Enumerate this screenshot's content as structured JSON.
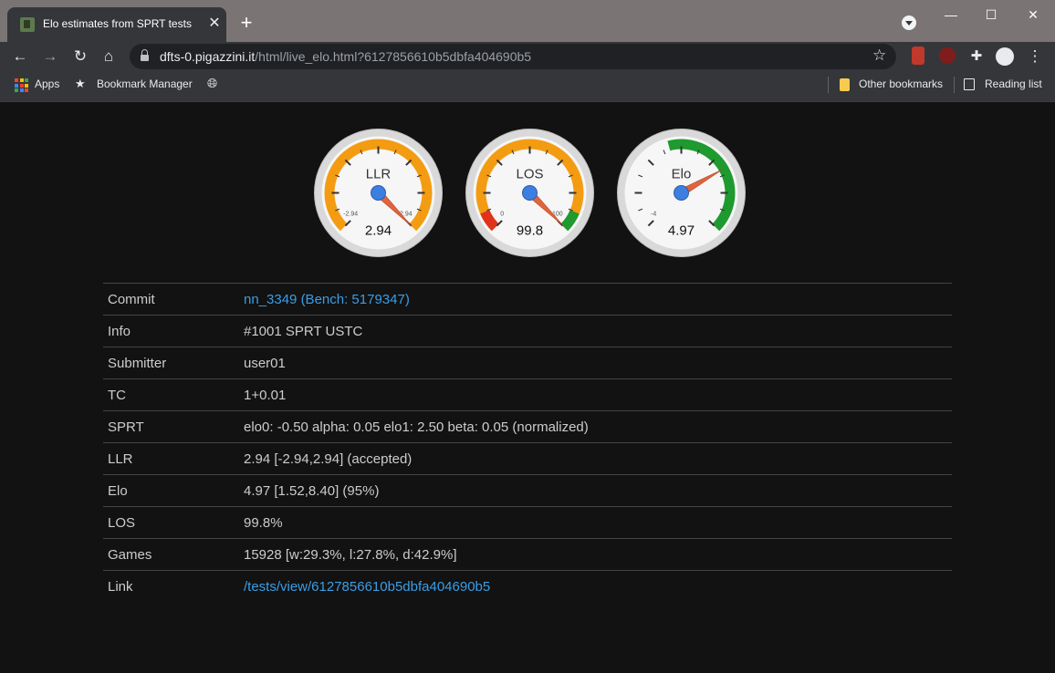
{
  "browser": {
    "tab_title": "Elo estimates from SPRT tests",
    "url_host": "dfts-0.pigazzini.it",
    "url_path": "/html/live_elo.html?6127856610b5dbfa404690b5",
    "bookmarks": [
      "Apps",
      "Bookmark Manager"
    ],
    "other_bookmarks": "Other bookmarks",
    "reading_list": "Reading list"
  },
  "gauges": [
    {
      "name": "LLR",
      "value_text": "2.94",
      "value": 2.94,
      "min": -2.94,
      "max": 2.94,
      "min_label": "-2.94",
      "max_label": "2.94",
      "colors": {
        "red": "#f39c12",
        "green": "#f39c12"
      }
    },
    {
      "name": "LOS",
      "value_text": "99.8",
      "value": 99.8,
      "min": 0,
      "max": 100,
      "min_label": "0",
      "max_label": "100",
      "colors": {
        "red": "#e0331c",
        "green": "#1e9a2e"
      }
    },
    {
      "name": "Elo",
      "value_text": "4.97",
      "value": 4.97,
      "min": -4,
      "max": 8.4,
      "min_label": "-4",
      "max_label": "",
      "colors": {
        "red": "#ffffff",
        "green": "#1e9a2e"
      }
    }
  ],
  "table": {
    "rows": [
      {
        "key": "Commit",
        "value": "nn_3349 (Bench: 5179347)",
        "link": true
      },
      {
        "key": "Info",
        "value": "#1001 SPRT USTC",
        "link": false
      },
      {
        "key": "Submitter",
        "value": "user01",
        "link": false
      },
      {
        "key": "TC",
        "value": "1+0.01",
        "link": false
      },
      {
        "key": "SPRT",
        "value": "elo0: -0.50  alpha: 0.05  elo1: 2.50  beta: 0.05 (normalized)",
        "link": false
      },
      {
        "key": "LLR",
        "value": "2.94 [-2.94,2.94] (accepted)",
        "link": false
      },
      {
        "key": "Elo",
        "value": "4.97 [1.52,8.40] (95%)",
        "link": false
      },
      {
        "key": "LOS",
        "value": "99.8%",
        "link": false
      },
      {
        "key": "Games",
        "value": "15928 [w:29.3%, l:27.8%, d:42.9%]",
        "link": false
      },
      {
        "key": "Link",
        "value": "/tests/view/6127856610b5dbfa404690b5",
        "link": true
      }
    ]
  },
  "colors": {
    "orange": "#f39c12",
    "link": "#3b9de4",
    "needle_hub": "#3d7fe0"
  }
}
